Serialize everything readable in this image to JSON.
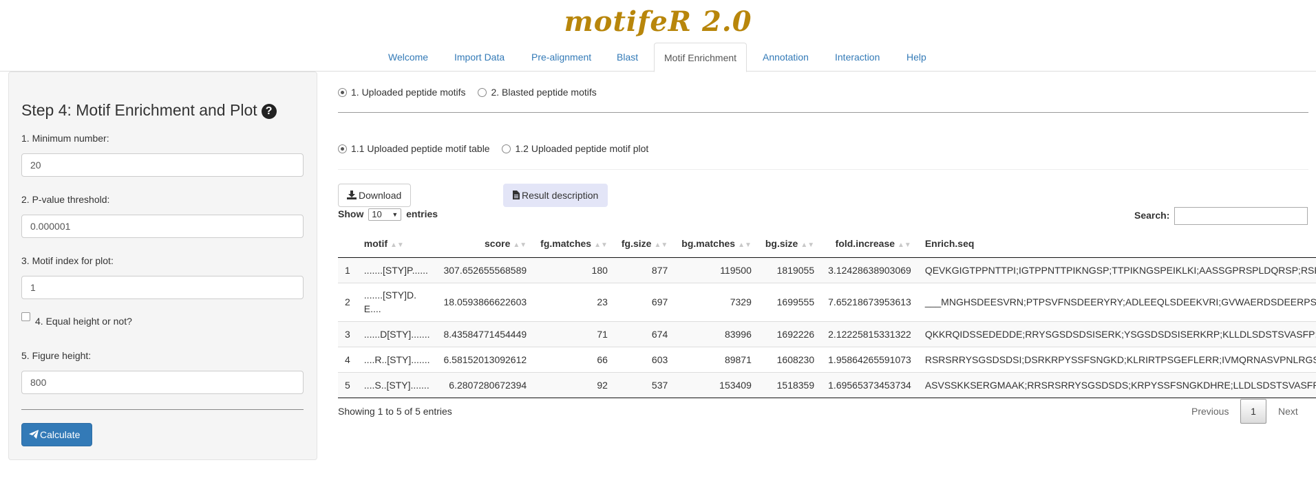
{
  "app": {
    "title": "motifeR 2.0"
  },
  "tabs": [
    {
      "label": "Welcome"
    },
    {
      "label": "Import Data"
    },
    {
      "label": "Pre-alignment"
    },
    {
      "label": "Blast"
    },
    {
      "label": "Motif Enrichment"
    },
    {
      "label": "Annotation"
    },
    {
      "label": "Interaction"
    },
    {
      "label": "Help"
    }
  ],
  "sidebar": {
    "title": "Step 4: Motif Enrichment and Plot",
    "help_icon": "question-circle-icon",
    "min_number": {
      "label": "1. Minimum number:",
      "value": "20"
    },
    "pvalue": {
      "label": "2. P-value threshold:",
      "value": "0.000001"
    },
    "motif_index": {
      "label": "3. Motif index for plot:",
      "value": "1"
    },
    "equal_height": {
      "label": "4. Equal height or not?",
      "checked": false
    },
    "fig_height": {
      "label": "5. Figure height:",
      "value": "800"
    },
    "calculate_label": "Calculate"
  },
  "main": {
    "source_options": [
      {
        "label": "1. Uploaded peptide motifs",
        "checked": true
      },
      {
        "label": "2. Blasted peptide motifs",
        "checked": false
      }
    ],
    "view_options": [
      {
        "label": "1.1 Uploaded peptide motif table",
        "checked": true
      },
      {
        "label": "1.2 Uploaded peptide motif plot",
        "checked": false
      }
    ],
    "download_label": "Download",
    "result_desc_label": "Result description",
    "show_label": "Show",
    "page_length": "10",
    "entries_label": "entries",
    "search_label": "Search:",
    "search_value": ""
  },
  "table": {
    "columns": [
      "",
      "motif",
      "score",
      "fg.matches",
      "fg.size",
      "bg.matches",
      "bg.size",
      "fold.increase",
      "Enrich.seq"
    ],
    "rows": [
      [
        "1",
        ".......[STY]P......",
        "307.652655568589",
        "180",
        "877",
        "119500",
        "1819055",
        "3.12428638903069",
        "QEVKGIGTPPNTTPI;IGTPPNTTPIKNGSP;TTPIKNGSPEIKLKI;AASSGPRSPLDQRSP;RSPLDSPRSPLRFTV"
      ],
      [
        "2",
        ".......[STY]D.E....",
        "18.0593866622603",
        "23",
        "697",
        "7329",
        "1699555",
        "7.65218673953613",
        "___MNGHSDEESVRN;PTPSVFNSDEERYRY;ADLEEQLSDEEKVRI;GVWAERDSDEERPSF;EEMEDKSDEGE"
      ],
      [
        "3",
        "......D[STY].......",
        "8.43584771454449",
        "71",
        "674",
        "83996",
        "1692226",
        "2.12225815331322",
        "QKKRQIDSSEDEDDE;RRYSGSDSDSISERK;YSGSDSDSISERKRP;KLLDLSDSTSVASFP;LGSDLDSTSV"
      ],
      [
        "4",
        "....R..[STY].......",
        "6.58152013092612",
        "66",
        "603",
        "89871",
        "1608230",
        "1.95864265591073",
        "RSRSRRYSGSDSDSI;DSRKRPYSSFSNGKD;KLRIRTPSGEFLERR;IVMQRNASVPNLRGS;PKRSRSASPS"
      ],
      [
        "5",
        "....S..[STY].......",
        "6.2807280672394",
        "92",
        "537",
        "153409",
        "1518359",
        "1.69565373453734",
        "ASVSSKKSERGMAAK;RRSRSRRYSGSDSDS;KRPYSSFSNGKDHRE;LLDLSDSTSVASFPS;SDSTSVASFP"
      ]
    ]
  },
  "footer": {
    "info": "Showing 1 to 5 of 5 entries",
    "previous_label": "Previous",
    "current_page": "1",
    "next_label": "Next"
  }
}
